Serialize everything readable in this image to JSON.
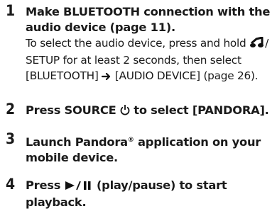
{
  "steps": [
    {
      "number": "1",
      "heading_lines": [
        "Make BLUETOOTH connection with the",
        "audio device (page 11)."
      ],
      "desc": {
        "line1_before_icon": "To select the audio device, press and hold ",
        "line1_after_icon": "/",
        "line2": "SETUP for at least 2 seconds, then select",
        "line3_a": "[BLUETOOTH] ",
        "line3_b": " [AUDIO DEVICE] (page 26).",
        "icons": [
          "music-note-icon",
          "arrow-right-icon"
        ]
      }
    },
    {
      "number": "2",
      "heading_before_icon": "Press SOURCE ",
      "heading_after_icon": " to select [PANDORA].",
      "icon": "power-icon"
    },
    {
      "number": "3",
      "heading_l1_before_reg": "Launch Pandora",
      "reg": "®",
      "heading_l1_after_reg": " application on your",
      "heading_l2": "mobile device."
    },
    {
      "number": "4",
      "heading_before_icon": "Press ",
      "heading_after_icon": " (play/pause) to start",
      "heading_l2": "playback.",
      "icon": "play-pause-icon"
    }
  ]
}
